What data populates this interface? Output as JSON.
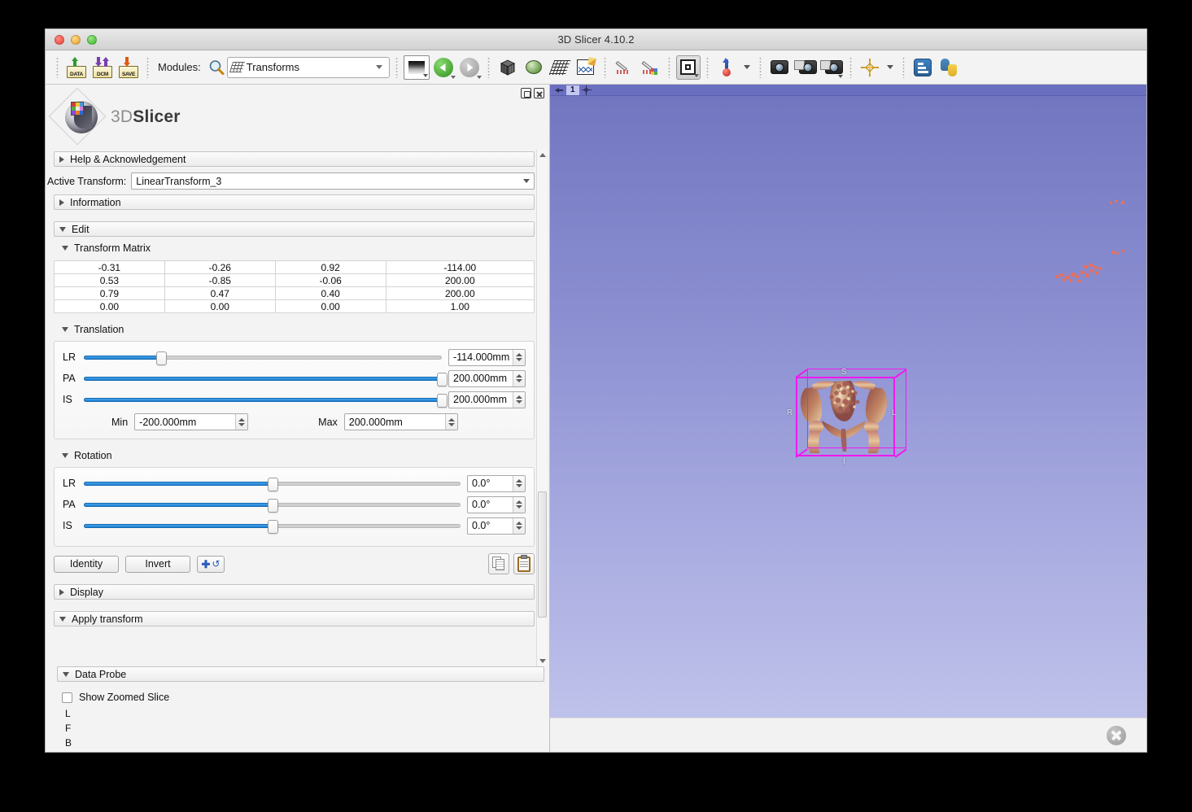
{
  "window": {
    "title": "3D Slicer 4.10.2",
    "traffic_lights": [
      "close",
      "minimize",
      "maximize"
    ]
  },
  "toolbar": {
    "io_buttons": [
      {
        "label": "DATA",
        "name": "load-data-button"
      },
      {
        "label": "DCM",
        "name": "load-dicom-button"
      },
      {
        "label": "SAVE",
        "name": "save-data-button"
      }
    ],
    "modules_label": "Modules:",
    "search_icon": "magnifier-icon",
    "module_combo": {
      "value": "Transforms",
      "icon": "transform-grid-icon"
    },
    "icons": [
      "layout-selector-icon",
      "previous-module-icon",
      "next-module-icon",
      "volumes-icon",
      "models-icon",
      "transforms-icon",
      "charts-icon",
      "markups-icon",
      "annotations-icon",
      "roi-toggle-icon",
      "fiducial-icon",
      "screenshot-icon",
      "scene-view-capture-icon",
      "scene-views-icon",
      "crosshair-icon",
      "extension-manager-icon",
      "python-console-icon"
    ]
  },
  "module_panel": {
    "panel_buttons": [
      "restore-panel",
      "close-panel"
    ],
    "logo": {
      "text_prefix": "3D",
      "text_bold": "Slicer"
    },
    "sections": {
      "help": "Help & Acknowledgement",
      "information": "Information",
      "edit": "Edit",
      "transform_matrix": "Transform Matrix",
      "translation": "Translation",
      "rotation": "Rotation",
      "display": "Display",
      "apply_transform": "Apply transform"
    },
    "active_transform": {
      "label": "Active Transform:",
      "value": "LinearTransform_3"
    },
    "matrix": {
      "rows": [
        [
          "-0.31",
          "-0.26",
          "0.92",
          "-114.00"
        ],
        [
          "0.53",
          "-0.85",
          "-0.06",
          "200.00"
        ],
        [
          "0.79",
          "0.47",
          "0.40",
          "200.00"
        ],
        [
          "0.00",
          "0.00",
          "0.00",
          "1.00"
        ]
      ]
    },
    "translation": {
      "sliders": [
        {
          "label": "LR",
          "value": "-114.000mm",
          "percent": 21.5
        },
        {
          "label": "PA",
          "value": "200.000mm",
          "percent": 100
        },
        {
          "label": "IS",
          "value": "200.000mm",
          "percent": 100
        }
      ],
      "min_label": "Min",
      "min_value": "-200.000mm",
      "max_label": "Max",
      "max_value": "200.000mm"
    },
    "rotation": {
      "sliders": [
        {
          "label": "LR",
          "value": "0.0°",
          "percent": 50
        },
        {
          "label": "PA",
          "value": "0.0°",
          "percent": 50
        },
        {
          "label": "IS",
          "value": "0.0°",
          "percent": 50
        }
      ]
    },
    "buttons": {
      "identity": "Identity",
      "invert": "Invert",
      "transform_tools_icon": "plus-rotate-icon",
      "copy_icon": "copy-icon",
      "paste_icon": "paste-icon"
    },
    "data_probe": {
      "title": "Data Probe",
      "show_zoomed_slice": "Show Zoomed Slice",
      "lines": [
        "L",
        "F",
        "B"
      ]
    }
  },
  "view": {
    "bar": {
      "pin_icon": "pin-icon",
      "number": "1",
      "center_icon": "center-view-icon"
    },
    "orientation_letters": {
      "superior": "S",
      "right": "R",
      "left": "L",
      "inferior": "I"
    },
    "colors": {
      "background_top": "#7276c0",
      "background_bottom": "#bfc2ea",
      "roi_box": "#f018f0",
      "bone_light": "#e8c9a4",
      "bone_dark": "#8a4a48",
      "speck": "#e8705e"
    }
  },
  "status_bar": {
    "error_log_icon": "error-close-icon"
  }
}
